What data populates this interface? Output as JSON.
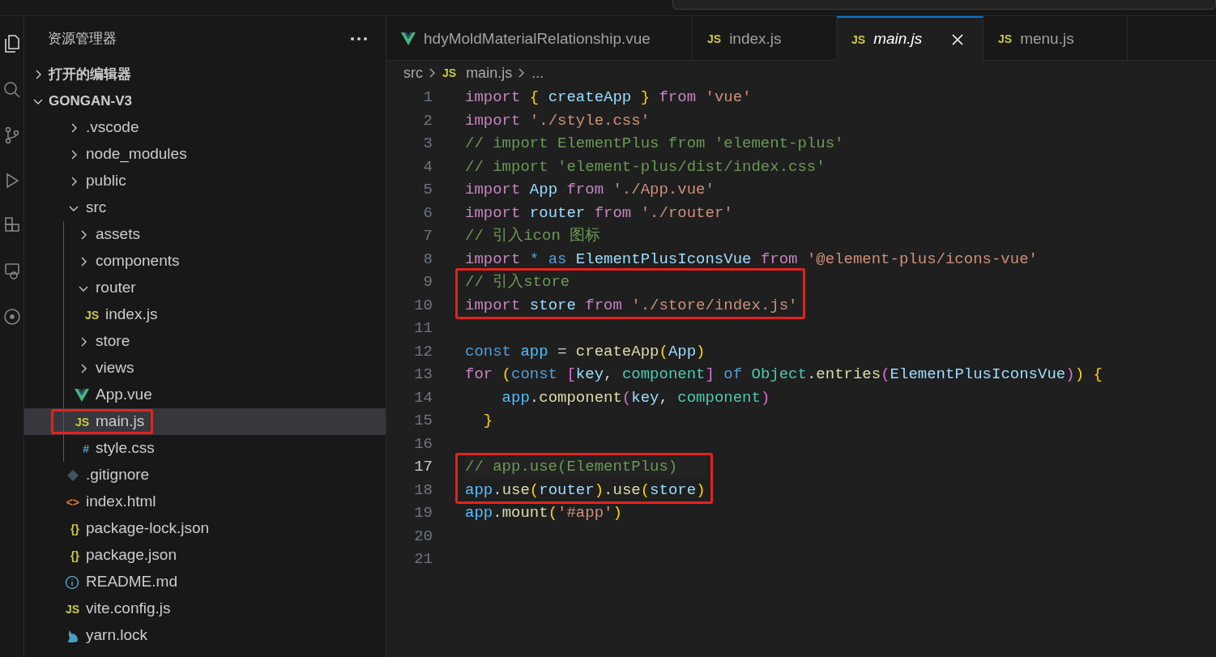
{
  "sidebar": {
    "title": "资源管理器",
    "sections": [
      {
        "label": "打开的编辑器",
        "expanded": false
      },
      {
        "label": "GONGAN-V3",
        "expanded": true,
        "children": [
          {
            "label": ".vscode",
            "kind": "folder",
            "expanded": false
          },
          {
            "label": "node_modules",
            "kind": "folder",
            "expanded": false
          },
          {
            "label": "public",
            "kind": "folder",
            "expanded": false
          },
          {
            "label": "src",
            "kind": "folder",
            "expanded": true,
            "children": [
              {
                "label": "assets",
                "kind": "folder",
                "expanded": false
              },
              {
                "label": "components",
                "kind": "folder",
                "expanded": false
              },
              {
                "label": "router",
                "kind": "folder",
                "expanded": true,
                "children": [
                  {
                    "label": "index.js",
                    "kind": "js",
                    "glyph": "JS",
                    "selected": false,
                    "boxed": false
                  }
                ]
              },
              {
                "label": "store",
                "kind": "folder",
                "expanded": false
              },
              {
                "label": "views",
                "kind": "folder",
                "expanded": false
              },
              {
                "label": "App.vue",
                "kind": "vue",
                "selected": false,
                "boxed": false
              },
              {
                "label": "main.js",
                "kind": "js",
                "glyph": "JS",
                "selected": true,
                "boxed": true
              },
              {
                "label": "style.css",
                "kind": "css",
                "glyph": "#",
                "selected": false,
                "boxed": false
              }
            ]
          },
          {
            "label": ".gitignore",
            "kind": "git",
            "selected": false,
            "boxed": false
          },
          {
            "label": "index.html",
            "kind": "html",
            "glyph": "<>",
            "selected": false,
            "boxed": false
          },
          {
            "label": "package-lock.json",
            "kind": "json",
            "glyph": "{}",
            "selected": false,
            "boxed": false
          },
          {
            "label": "package.json",
            "kind": "json",
            "glyph": "{}",
            "selected": false,
            "boxed": false
          },
          {
            "label": "README.md",
            "kind": "info",
            "selected": false,
            "boxed": false
          },
          {
            "label": "vite.config.js",
            "kind": "js",
            "glyph": "JS",
            "selected": false,
            "boxed": false
          },
          {
            "label": "yarn.lock",
            "kind": "yarn",
            "selected": false,
            "boxed": false
          }
        ]
      }
    ]
  },
  "tabs": [
    {
      "label": "hdyMoldMaterialRelationship.vue",
      "kind": "vue",
      "selected": false,
      "preview": false
    },
    {
      "label": "index.js",
      "kind": "js",
      "glyph": "JS",
      "selected": false,
      "preview": false
    },
    {
      "label": "main.js",
      "kind": "js",
      "glyph": "JS",
      "selected": true,
      "preview": true
    },
    {
      "label": "menu.js",
      "kind": "js",
      "glyph": "JS",
      "selected": false,
      "preview": false
    }
  ],
  "breadcrumb": [
    {
      "label": "src",
      "kind": "folder"
    },
    {
      "label": "main.js",
      "kind": "js",
      "glyph": "JS"
    },
    {
      "label": "...",
      "kind": "more"
    }
  ],
  "editor": {
    "lines": [
      {
        "number": "1",
        "current": false,
        "boxed": false,
        "tokens": [
          {
            "text": "import ",
            "kind": "kw"
          },
          {
            "text": "{",
            "kind": "b1"
          },
          {
            "text": " createApp ",
            "kind": "var"
          },
          {
            "text": "}",
            "kind": "b1"
          },
          {
            "text": " from ",
            "kind": "kw"
          },
          {
            "text": "'vue'",
            "kind": "str"
          }
        ]
      },
      {
        "number": "2",
        "current": false,
        "boxed": false,
        "tokens": [
          {
            "text": "import ",
            "kind": "kw"
          },
          {
            "text": "'./style.css'",
            "kind": "str"
          }
        ]
      },
      {
        "number": "3",
        "current": false,
        "boxed": false,
        "tokens": [
          {
            "text": "// import ElementPlus from 'element-plus'",
            "kind": "comment"
          }
        ]
      },
      {
        "number": "4",
        "current": false,
        "boxed": false,
        "tokens": [
          {
            "text": "// import 'element-plus/dist/index.css'",
            "kind": "comment"
          }
        ]
      },
      {
        "number": "5",
        "current": false,
        "boxed": false,
        "tokens": [
          {
            "text": "import ",
            "kind": "kw"
          },
          {
            "text": "App ",
            "kind": "var"
          },
          {
            "text": "from ",
            "kind": "kw"
          },
          {
            "text": "'./App.vue'",
            "kind": "str"
          }
        ]
      },
      {
        "number": "6",
        "current": false,
        "boxed": false,
        "tokens": [
          {
            "text": "import ",
            "kind": "kw"
          },
          {
            "text": "router ",
            "kind": "var"
          },
          {
            "text": "from ",
            "kind": "kw"
          },
          {
            "text": "'./router'",
            "kind": "str"
          }
        ]
      },
      {
        "number": "7",
        "current": false,
        "boxed": false,
        "tokens": [
          {
            "text": "// 引入icon 图标",
            "kind": "comment"
          }
        ]
      },
      {
        "number": "8",
        "current": false,
        "boxed": false,
        "tokens": [
          {
            "text": "import ",
            "kind": "kw"
          },
          {
            "text": "* as ",
            "kind": "storage"
          },
          {
            "text": "ElementPlusIconsVue ",
            "kind": "var"
          },
          {
            "text": "from ",
            "kind": "kw"
          },
          {
            "text": "'@element-plus/icons-vue'",
            "kind": "str"
          }
        ]
      },
      {
        "number": "9",
        "current": false,
        "boxed": true,
        "tokens": [
          {
            "text": "// 引入store",
            "kind": "comment"
          }
        ]
      },
      {
        "number": "10",
        "current": false,
        "boxed": true,
        "tokens": [
          {
            "text": "import ",
            "kind": "kw"
          },
          {
            "text": "store ",
            "kind": "var"
          },
          {
            "text": "from ",
            "kind": "kw"
          },
          {
            "text": "'./store/index.js'",
            "kind": "str"
          }
        ]
      },
      {
        "number": "11",
        "current": false,
        "boxed": false
      },
      {
        "number": "12",
        "current": false,
        "boxed": false,
        "tokens": [
          {
            "text": "const ",
            "kind": "storage"
          },
          {
            "text": "app",
            "kind": "const"
          },
          {
            "text": " = ",
            "kind": "plain"
          },
          {
            "text": "createApp",
            "kind": "func"
          },
          {
            "text": "(",
            "kind": "b1"
          },
          {
            "text": "App",
            "kind": "var"
          },
          {
            "text": ")",
            "kind": "b1"
          }
        ]
      },
      {
        "number": "13",
        "current": false,
        "boxed": false,
        "tokens": [
          {
            "text": "for ",
            "kind": "kw"
          },
          {
            "text": "(",
            "kind": "b1"
          },
          {
            "text": "const ",
            "kind": "storage"
          },
          {
            "text": "[",
            "kind": "b2"
          },
          {
            "text": "key",
            "kind": "var"
          },
          {
            "text": ", ",
            "kind": "plain"
          },
          {
            "text": "component",
            "kind": "type"
          },
          {
            "text": "]",
            "kind": "b2"
          },
          {
            "text": " of ",
            "kind": "storage"
          },
          {
            "text": "Object",
            "kind": "type"
          },
          {
            "text": ".",
            "kind": "plain"
          },
          {
            "text": "entries",
            "kind": "func"
          },
          {
            "text": "(",
            "kind": "b2"
          },
          {
            "text": "ElementPlusIconsVue",
            "kind": "var"
          },
          {
            "text": ")",
            "kind": "b2"
          },
          {
            "text": ") ",
            "kind": "b1"
          },
          {
            "text": "{",
            "kind": "b1"
          }
        ]
      },
      {
        "number": "14",
        "current": false,
        "boxed": false,
        "tokens": [
          {
            "text": "    app",
            "kind": "const"
          },
          {
            "text": ".",
            "kind": "plain"
          },
          {
            "text": "component",
            "kind": "func"
          },
          {
            "text": "(",
            "kind": "b2"
          },
          {
            "text": "key",
            "kind": "var"
          },
          {
            "text": ", ",
            "kind": "plain"
          },
          {
            "text": "component",
            "kind": "type"
          },
          {
            "text": ")",
            "kind": "b2"
          }
        ]
      },
      {
        "number": "15",
        "current": false,
        "boxed": false,
        "tokens": [
          {
            "text": "  }",
            "kind": "b1"
          }
        ]
      },
      {
        "number": "16",
        "current": false,
        "boxed": false
      },
      {
        "number": "17",
        "current": true,
        "boxed": true,
        "tokens": [
          {
            "text": "// app.use(ElementPlus)",
            "kind": "comment"
          }
        ]
      },
      {
        "number": "18",
        "current": false,
        "boxed": true,
        "tokens": [
          {
            "text": "app",
            "kind": "const"
          },
          {
            "text": ".",
            "kind": "plain"
          },
          {
            "text": "use",
            "kind": "func"
          },
          {
            "text": "(",
            "kind": "b1"
          },
          {
            "text": "router",
            "kind": "var"
          },
          {
            "text": ")",
            "kind": "b1"
          },
          {
            "text": ".",
            "kind": "plain"
          },
          {
            "text": "use",
            "kind": "func"
          },
          {
            "text": "(",
            "kind": "b1"
          },
          {
            "text": "store",
            "kind": "var"
          },
          {
            "text": ")",
            "kind": "b1"
          }
        ]
      },
      {
        "number": "19",
        "current": false,
        "boxed": false,
        "tokens": [
          {
            "text": "app",
            "kind": "const"
          },
          {
            "text": ".",
            "kind": "plain"
          },
          {
            "text": "mount",
            "kind": "func"
          },
          {
            "text": "(",
            "kind": "b1"
          },
          {
            "text": "'#app'",
            "kind": "str"
          },
          {
            "text": ")",
            "kind": "b1"
          }
        ]
      },
      {
        "number": "20",
        "current": false,
        "boxed": false
      },
      {
        "number": "21",
        "current": false,
        "boxed": false
      }
    ]
  }
}
